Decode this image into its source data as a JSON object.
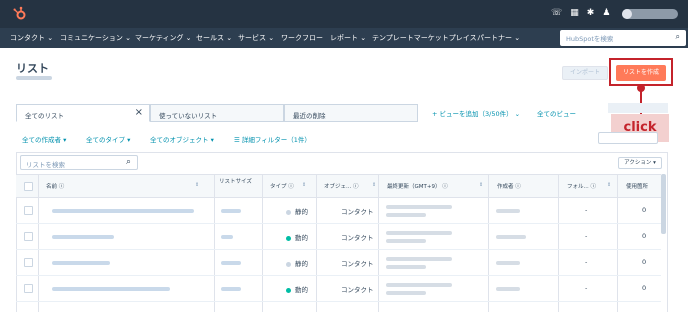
{
  "colors": {
    "topbar": "#253342",
    "accent": "#ff7a59",
    "link": "#0091ae",
    "annotation": "#c4232b"
  },
  "topbar": {
    "logo_icon": "hubspot-sprocket-icon",
    "icons": [
      "phone-icon",
      "marketplace-icon",
      "settings-icon",
      "notifications-icon"
    ]
  },
  "nav": {
    "items": [
      "コンタクト",
      "コミュニケーション",
      "マーケティング",
      "セールス",
      "サービス",
      "ワークフロー",
      "レポート",
      "テンプレートマーケットプレイス",
      "パートナー"
    ],
    "search_placeholder": "HubSpotを検索"
  },
  "page": {
    "title": "リスト",
    "import_label": "インポート",
    "create_label": "リストを作成"
  },
  "annotation": {
    "click_label": "click"
  },
  "tabs": {
    "items": [
      "全てのリスト",
      "使っていないリスト",
      "最近の削除"
    ],
    "add_view": "+ ビューを追加（3/50件）",
    "all_views": "全てのビュー"
  },
  "filters": {
    "creator": "全ての作成者",
    "type": "全てのタイプ",
    "object": "全てのオブジェクト",
    "advanced": "詳細フィルター（1件）"
  },
  "table": {
    "search_placeholder": "リストを検索",
    "actions_label": "アクション",
    "headers": {
      "name": "名前",
      "size": "リストサイズ",
      "type": "タイプ",
      "object": "オブジェ...",
      "updated": "最終更新（GMT+9）",
      "creator": "作成者",
      "folder": "フォル...",
      "usage": "使用箇所"
    },
    "rows": [
      {
        "type": "静的",
        "type_color": "#cbd6e2",
        "object": "コンタクト",
        "folder": "-",
        "usage": "0"
      },
      {
        "type": "動的",
        "type_color": "#00bda5",
        "object": "コンタクト",
        "folder": "-",
        "usage": "0"
      },
      {
        "type": "静的",
        "type_color": "#cbd6e2",
        "object": "コンタクト",
        "folder": "-",
        "usage": "0"
      },
      {
        "type": "動的",
        "type_color": "#00bda5",
        "object": "コンタクト",
        "folder": "-",
        "usage": "0"
      }
    ]
  }
}
